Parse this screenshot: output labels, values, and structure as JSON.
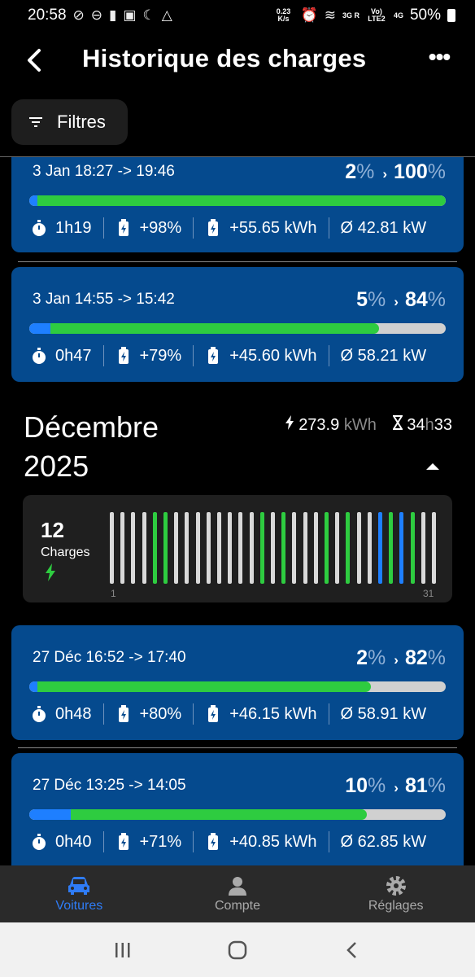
{
  "status_bar": {
    "time": "20:58",
    "net_speed": "0.23 K/s",
    "signal1": "3G R",
    "signal2": "Vo) LTE2",
    "signal3": "4G",
    "battery": "50%"
  },
  "header": {
    "title": "Historique des charges"
  },
  "filters": {
    "label": "Filtres"
  },
  "cards_top": [
    {
      "time": "3 Jan 18:27 -> 19:46",
      "start_pct": "2",
      "end_pct": "100",
      "start_frac": 0.02,
      "end_frac": 1.0,
      "duration": "1h19",
      "gain": "+98%",
      "energy": "+55.65 kWh",
      "power": "Ø 42.81 kW"
    },
    {
      "time": "3 Jan 14:55 -> 15:42",
      "start_pct": "5",
      "end_pct": "84",
      "start_frac": 0.05,
      "end_frac": 0.84,
      "duration": "0h47",
      "gain": "+79%",
      "energy": "+45.60 kWh",
      "power": "Ø 58.21 kW"
    }
  ],
  "month": {
    "title_line1": "Décembre",
    "title_line2": "2025",
    "energy_value": "273.9",
    "energy_unit": "kWh",
    "duration_hours": "34",
    "duration_h": "h",
    "duration_minutes": "33",
    "charge_count": "12",
    "charge_label": "Charges",
    "first_day": "1",
    "last_day": "31",
    "days": [
      "gray",
      "gray",
      "gray",
      "gray",
      "green",
      "green",
      "gray",
      "gray",
      "gray",
      "gray",
      "gray",
      "gray",
      "gray",
      "gray",
      "green",
      "gray",
      "green",
      "gray",
      "gray",
      "gray",
      "green",
      "gray",
      "green",
      "gray",
      "gray",
      "blue",
      "green",
      "blue",
      "green",
      "gray",
      "gray"
    ]
  },
  "cards_bottom": [
    {
      "time": "27 Déc 16:52 -> 17:40",
      "start_pct": "2",
      "end_pct": "82",
      "start_frac": 0.02,
      "end_frac": 0.82,
      "duration": "0h48",
      "gain": "+80%",
      "energy": "+46.15 kWh",
      "power": "Ø 58.91 kW"
    },
    {
      "time": "27 Déc 13:25 -> 14:05",
      "start_pct": "10",
      "end_pct": "81",
      "start_frac": 0.1,
      "end_frac": 0.81,
      "duration": "0h40",
      "gain": "+71%",
      "energy": "+40.85 kWh",
      "power": "Ø 62.85 kW"
    }
  ],
  "pct_sign": "%",
  "bottom_nav": [
    {
      "label": "Voitures",
      "icon": "car-icon"
    },
    {
      "label": "Compte",
      "icon": "person-icon"
    },
    {
      "label": "Réglages",
      "icon": "gear-icon"
    }
  ],
  "colors": {
    "card_bg": "#054a8e",
    "bar_green": "#2ecc40",
    "bar_blue": "#1e7fff",
    "bar_gray": "#d0d0d0",
    "active_nav": "#2f7cf6"
  }
}
